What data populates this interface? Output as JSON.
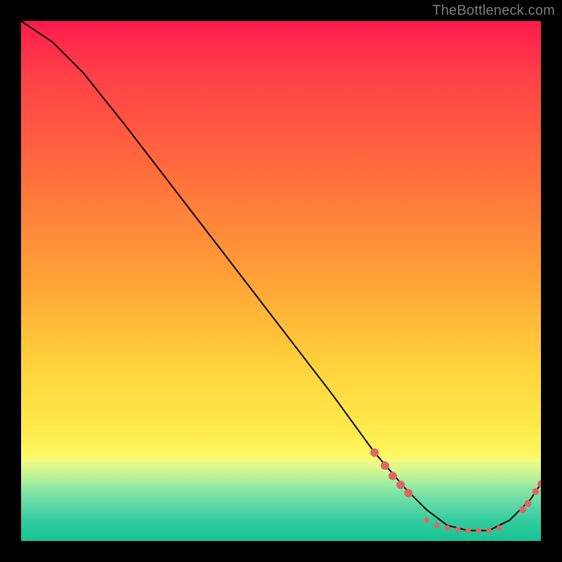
{
  "watermark": "TheBottleneck.com",
  "chart_data": {
    "type": "line",
    "title": "",
    "xlabel": "",
    "ylabel": "",
    "xlim": [
      0,
      100
    ],
    "ylim": [
      0,
      100
    ],
    "series": [
      {
        "name": "bottleneck-curve",
        "x": [
          0,
          6,
          12,
          20,
          30,
          40,
          50,
          60,
          68,
          74,
          78,
          82,
          86,
          90,
          94,
          98,
          100
        ],
        "y": [
          100,
          96,
          90,
          80,
          67,
          54,
          41,
          28,
          17,
          10,
          6,
          3,
          2,
          2,
          4,
          8,
          11
        ]
      }
    ],
    "markers": {
      "name": "highlight-points",
      "color": "#e06666",
      "points": [
        {
          "x": 68,
          "y": 17,
          "r": 6
        },
        {
          "x": 70,
          "y": 14.5,
          "r": 6
        },
        {
          "x": 71.5,
          "y": 12.5,
          "r": 6
        },
        {
          "x": 73,
          "y": 10.8,
          "r": 6
        },
        {
          "x": 74.5,
          "y": 9.2,
          "r": 6
        },
        {
          "x": 78,
          "y": 4,
          "r": 4
        },
        {
          "x": 80,
          "y": 3,
          "r": 4
        },
        {
          "x": 82,
          "y": 2.5,
          "r": 4
        },
        {
          "x": 84,
          "y": 2.2,
          "r": 4
        },
        {
          "x": 86,
          "y": 2,
          "r": 4
        },
        {
          "x": 88,
          "y": 2,
          "r": 4
        },
        {
          "x": 90,
          "y": 2,
          "r": 4
        },
        {
          "x": 92,
          "y": 2.5,
          "r": 4
        },
        {
          "x": 96.5,
          "y": 6,
          "r": 5
        },
        {
          "x": 97.5,
          "y": 7.2,
          "r": 5
        },
        {
          "x": 99,
          "y": 9.5,
          "r": 5
        },
        {
          "x": 100,
          "y": 11,
          "r": 5
        }
      ]
    }
  }
}
